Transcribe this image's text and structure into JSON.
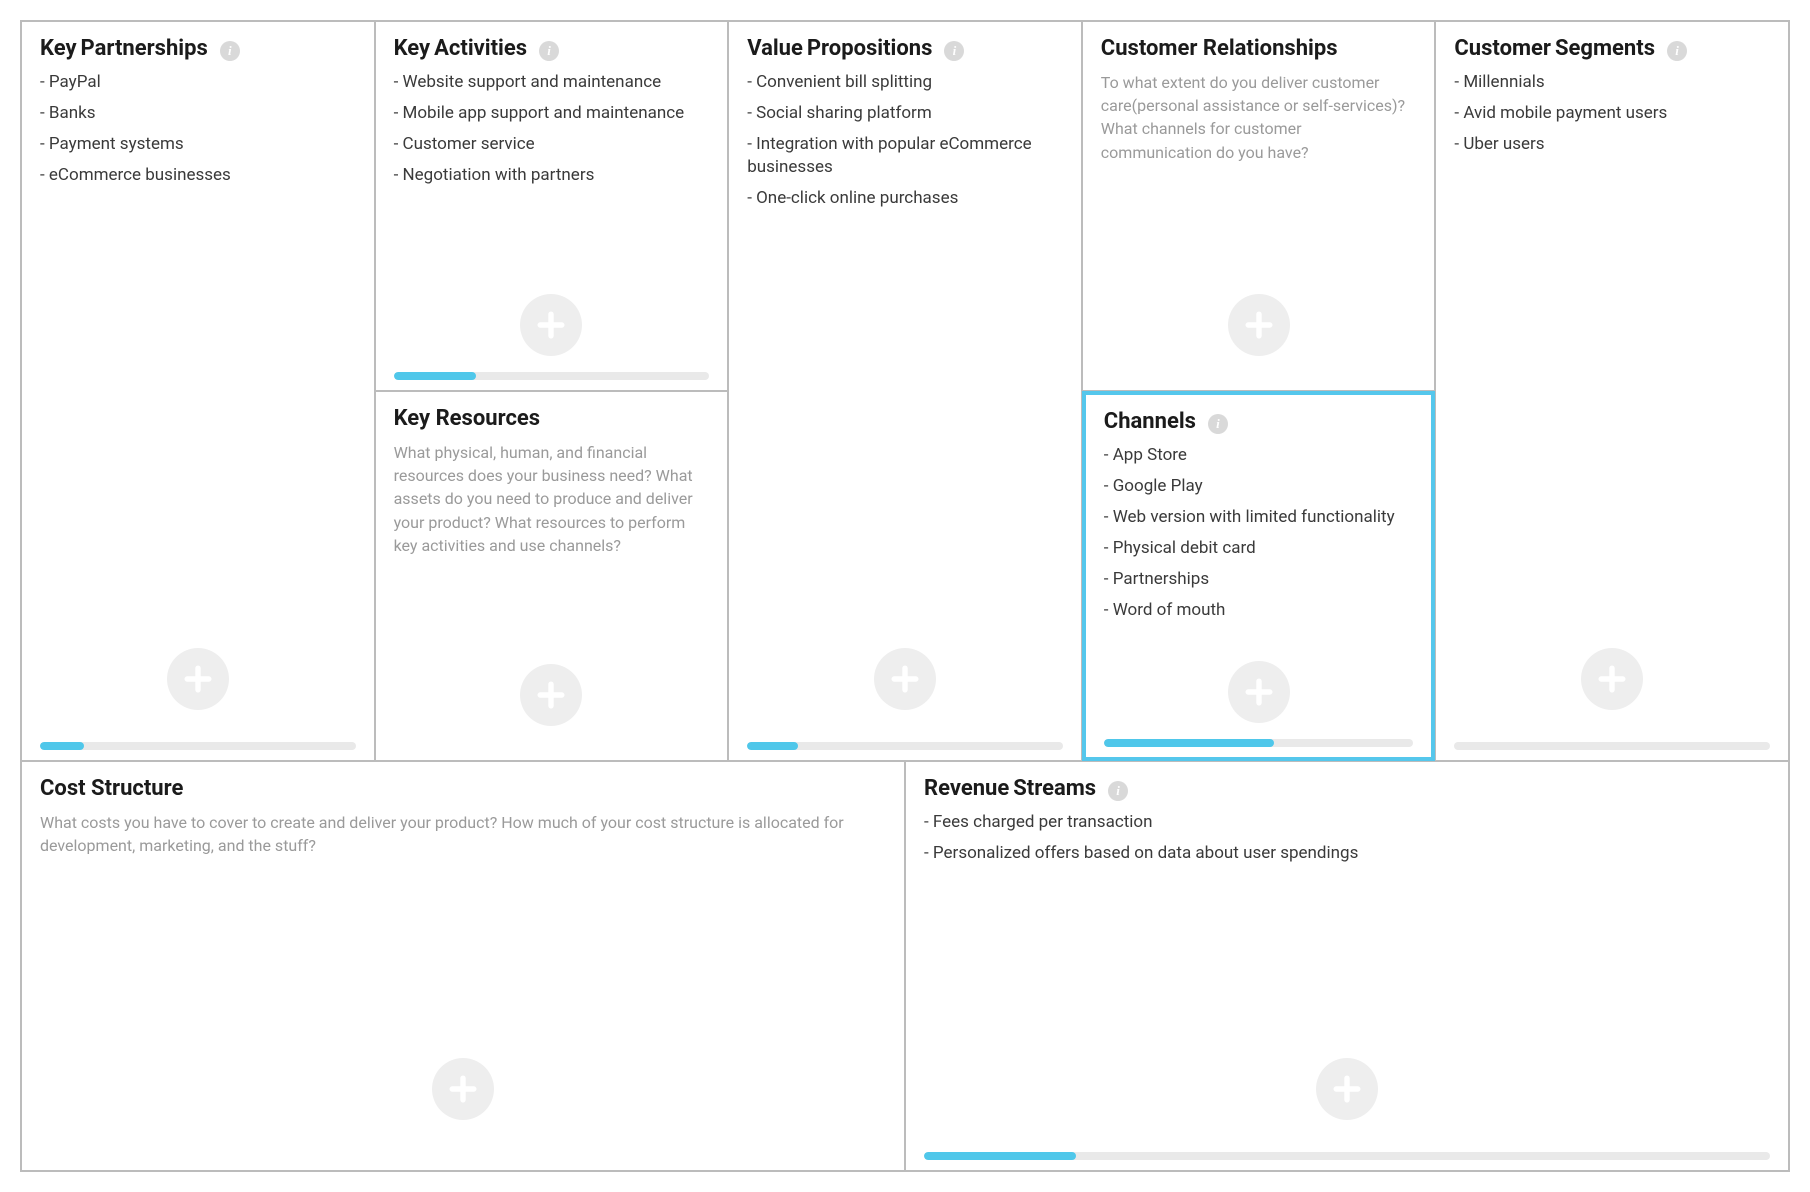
{
  "cells": {
    "key_partnerships": {
      "title_first": "Key",
      "title_rest": "Partnerships",
      "info": true,
      "items": [
        "PayPal",
        "Banks",
        "Payment systems",
        "eCommerce businesses"
      ],
      "placeholder": "",
      "progress_pct": 14
    },
    "key_activities": {
      "title_first": "Key",
      "title_rest": "Activities",
      "info": true,
      "items": [
        "Website support and maintenance",
        "Mobile app support and maintenance",
        "Customer service",
        "Negotiation with partners"
      ],
      "placeholder": "",
      "progress_pct": 26
    },
    "key_resources": {
      "title_first": "Key Resources",
      "title_rest": "",
      "info": false,
      "items": [],
      "placeholder": "What physical, human, and financial resources does your business need? What assets do you need to produce and deliver your product?\nWhat resources to perform key activities and use channels?",
      "progress_pct": 0
    },
    "value_propositions": {
      "title_first": "Value",
      "title_rest": "Propositions",
      "info": true,
      "items": [
        "Convenient bill splitting",
        "Social sharing platform",
        "Integration with popular eCommerce businesses",
        "One-click online purchases"
      ],
      "placeholder": "",
      "progress_pct": 16
    },
    "customer_relationships": {
      "title_first": "Customer Relationships",
      "title_rest": "",
      "info": false,
      "items": [],
      "placeholder": "To what extent do you deliver customer care(personal assistance or self-services)? What channels for customer communication do you have?",
      "progress_pct": 0
    },
    "channels": {
      "title_first": "Channels",
      "title_rest": "",
      "info": true,
      "items": [
        "App Store",
        "Google Play",
        "Web version with limited functionality",
        "Physical debit card",
        "Partnerships",
        "Word of mouth"
      ],
      "placeholder": "",
      "progress_pct": 55
    },
    "customer_segments": {
      "title_first": "Customer",
      "title_rest": "Segments",
      "info": true,
      "items": [
        "Millennials",
        "Avid mobile payment users",
        "Uber users"
      ],
      "placeholder": "",
      "progress_pct": 0
    },
    "cost_structure": {
      "title_first": "Cost Structure",
      "title_rest": "",
      "info": false,
      "items": [],
      "placeholder": "What costs you have to cover to create and deliver your product?\nHow much of your cost structure is allocated for development, marketing, and the stuff?",
      "progress_pct": 0
    },
    "revenue_streams": {
      "title_first": "Revenue",
      "title_rest": "Streams",
      "info": true,
      "items": [
        "Fees charged per transaction",
        "Personalized offers based on data about user spendings"
      ],
      "placeholder": "",
      "progress_pct": 18
    }
  },
  "icons": {
    "info_glyph": "i"
  },
  "selected_cell": "channels"
}
